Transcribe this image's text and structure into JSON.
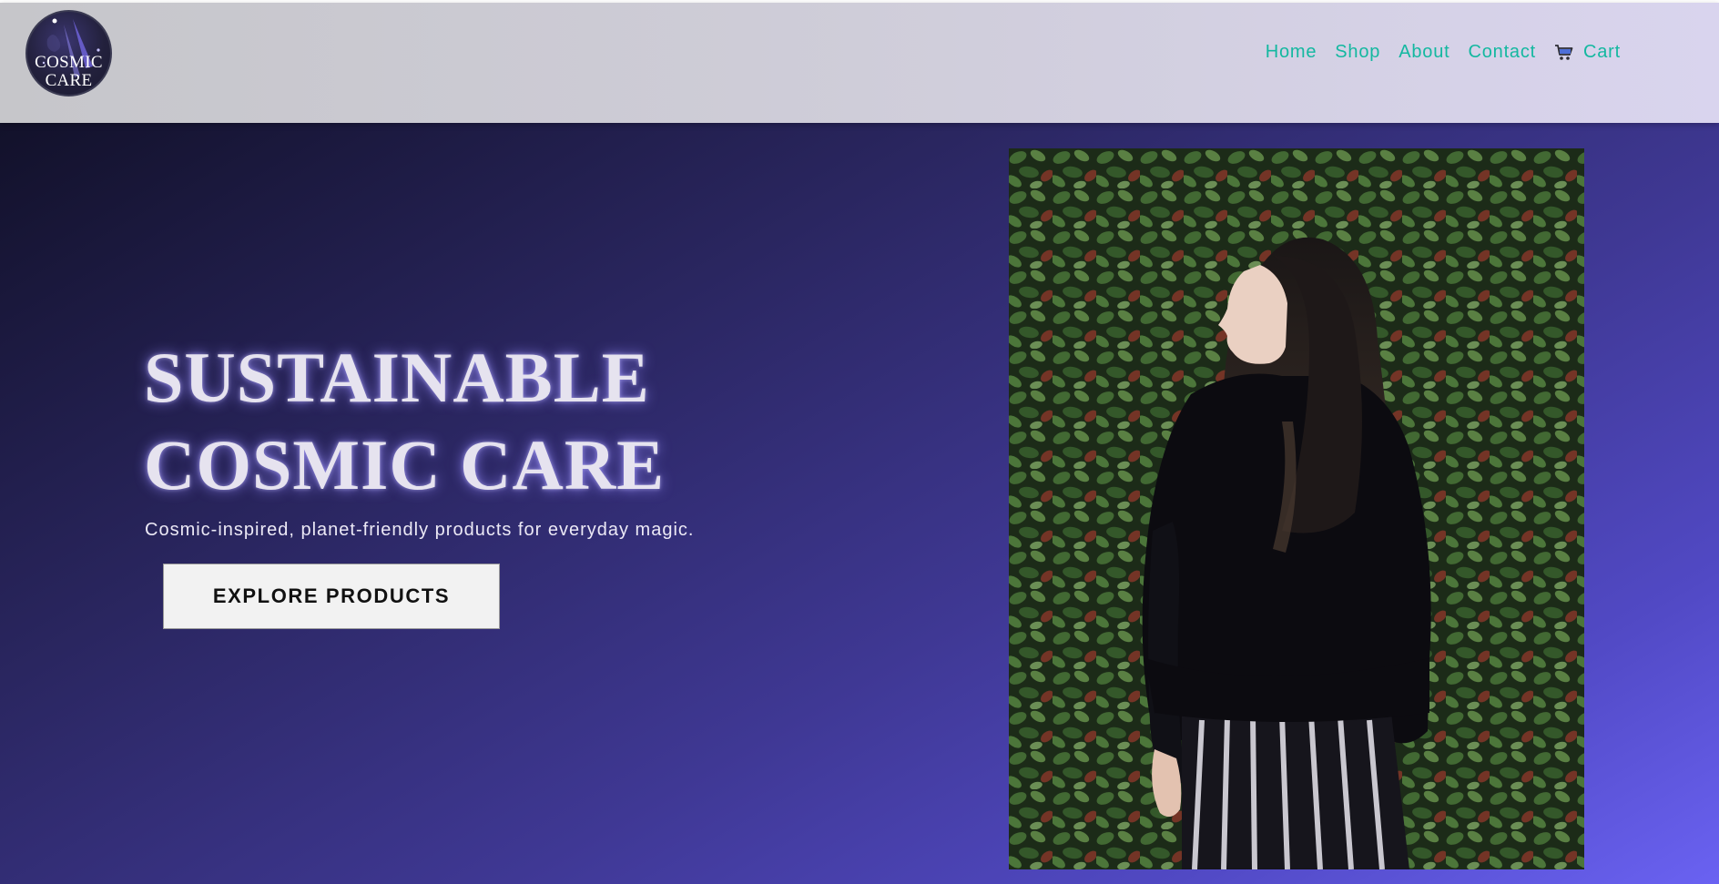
{
  "brand": {
    "logo_line1": "COSMIC",
    "logo_line2": "CARE"
  },
  "nav": {
    "items": [
      {
        "label": "Home"
      },
      {
        "label": "Shop"
      },
      {
        "label": "About"
      },
      {
        "label": "Contact"
      }
    ],
    "cart_label": "Cart",
    "cart_icon": "shopping-cart-icon",
    "link_color": "#13b8a0"
  },
  "hero": {
    "title_line1": "SUSTAINABLE",
    "title_line2": "COSMIC CARE",
    "subtitle": "Cosmic-inspired, planet-friendly products for everyday magic.",
    "cta_label": "EXPLORE PRODUCTS",
    "photo_alt": "Woman with long dark hair in a black sweater and striped trousers standing in front of a green leafy hedge"
  },
  "colors": {
    "accent": "#13b8a0",
    "hero_dark": "#12112a",
    "hero_light": "#6a62f2",
    "title_text": "#e6e3ef"
  }
}
